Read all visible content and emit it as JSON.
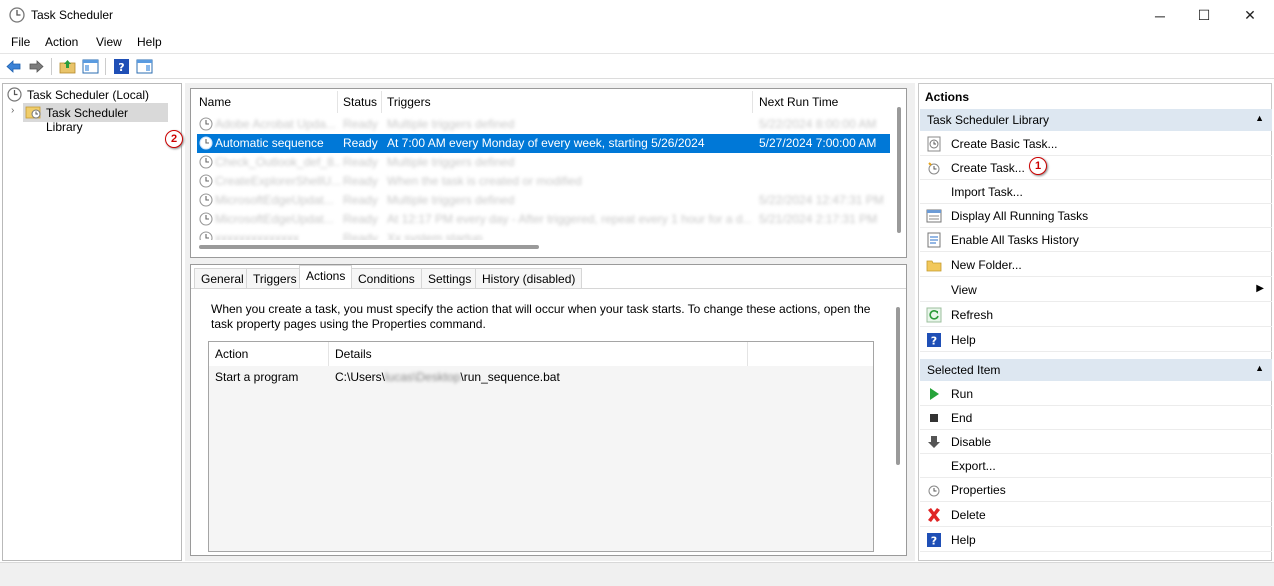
{
  "window": {
    "title": "Task Scheduler",
    "controls": {
      "minimize": "─",
      "maximize": "☐",
      "close": "✕"
    }
  },
  "menu": [
    "File",
    "Action",
    "View",
    "Help"
  ],
  "tree": {
    "root": "Task Scheduler (Local)",
    "library": "Task Scheduler Library"
  },
  "task_list": {
    "columns": [
      "Name",
      "Status",
      "Triggers",
      "Next Run Time"
    ],
    "rows": [
      {
        "name": "Adobe Acrobat Upda...",
        "status": "Ready",
        "triggers": "Multiple triggers defined",
        "next": "5/22/2024 8:00:00 AM",
        "blurred": true
      },
      {
        "name": "Automatic sequence",
        "status": "Ready",
        "triggers": "At 7:00 AM every Monday of every week, starting 5/26/2024",
        "next": "5/27/2024 7:00:00 AM",
        "selected": true
      },
      {
        "name": "Check_Outlook_def_8...",
        "status": "Ready",
        "triggers": "Multiple triggers defined",
        "next": "",
        "blurred": true
      },
      {
        "name": "CreateExplorerShellU...",
        "status": "Ready",
        "triggers": "When the task is created or modified",
        "next": "",
        "blurred": true
      },
      {
        "name": "MicrosoftEdgeUpdat...",
        "status": "Ready",
        "triggers": "Multiple triggers defined",
        "next": "5/22/2024 12:47:31 PM",
        "blurred": true
      },
      {
        "name": "MicrosoftEdgeUpdat...",
        "status": "Ready",
        "triggers": "At 12:17 PM every day - After triggered, repeat every 1 hour for a d...",
        "next": "5/21/2024 2:17:31 PM",
        "blurred": true
      },
      {
        "name": "xxxxxxxxxxxxxx",
        "status": "Ready",
        "triggers": "Xx system startup",
        "next": "",
        "blurred": true
      }
    ]
  },
  "detail_tabs": [
    "General",
    "Triggers",
    "Actions",
    "Conditions",
    "Settings",
    "History (disabled)"
  ],
  "actions_tab": {
    "description": "When you create a task, you must specify the action that will occur when your task starts.  To change these actions, open the task property pages using the Properties command.",
    "columns": [
      "Action",
      "Details"
    ],
    "rows": [
      {
        "action": "Start a program",
        "details_prefix": "C:\\Users\\",
        "details_blurred": "lucas\\Desktop",
        "details_suffix": "\\run_sequence.bat"
      }
    ]
  },
  "actions_pane": {
    "title": "Actions",
    "section1": "Task Scheduler Library",
    "section1_items": [
      {
        "label": "Create Basic Task...",
        "icon": "create-basic-task-icon"
      },
      {
        "label": "Create Task...",
        "icon": "create-task-icon"
      },
      {
        "label": "Import Task...",
        "icon": ""
      },
      {
        "label": "Display All Running Tasks",
        "icon": "running-tasks-icon"
      },
      {
        "label": "Enable All Tasks History",
        "icon": "history-icon"
      },
      {
        "label": "New Folder...",
        "icon": "folder-icon"
      },
      {
        "label": "View",
        "icon": ""
      },
      {
        "label": "Refresh",
        "icon": "refresh-icon"
      },
      {
        "label": "Help",
        "icon": "help-icon"
      }
    ],
    "section2": "Selected Item",
    "section2_items": [
      {
        "label": "Run",
        "icon": "run-icon"
      },
      {
        "label": "End",
        "icon": "end-icon"
      },
      {
        "label": "Disable",
        "icon": "disable-icon"
      },
      {
        "label": "Export...",
        "icon": ""
      },
      {
        "label": "Properties",
        "icon": "properties-icon"
      },
      {
        "label": "Delete",
        "icon": "delete-icon"
      },
      {
        "label": "Help",
        "icon": "help-icon"
      }
    ]
  },
  "callouts": {
    "one": "1",
    "two": "2"
  },
  "colors": {
    "selection": "#0078d7",
    "section_header": "#dde7f1",
    "callout": "#cc0000"
  }
}
